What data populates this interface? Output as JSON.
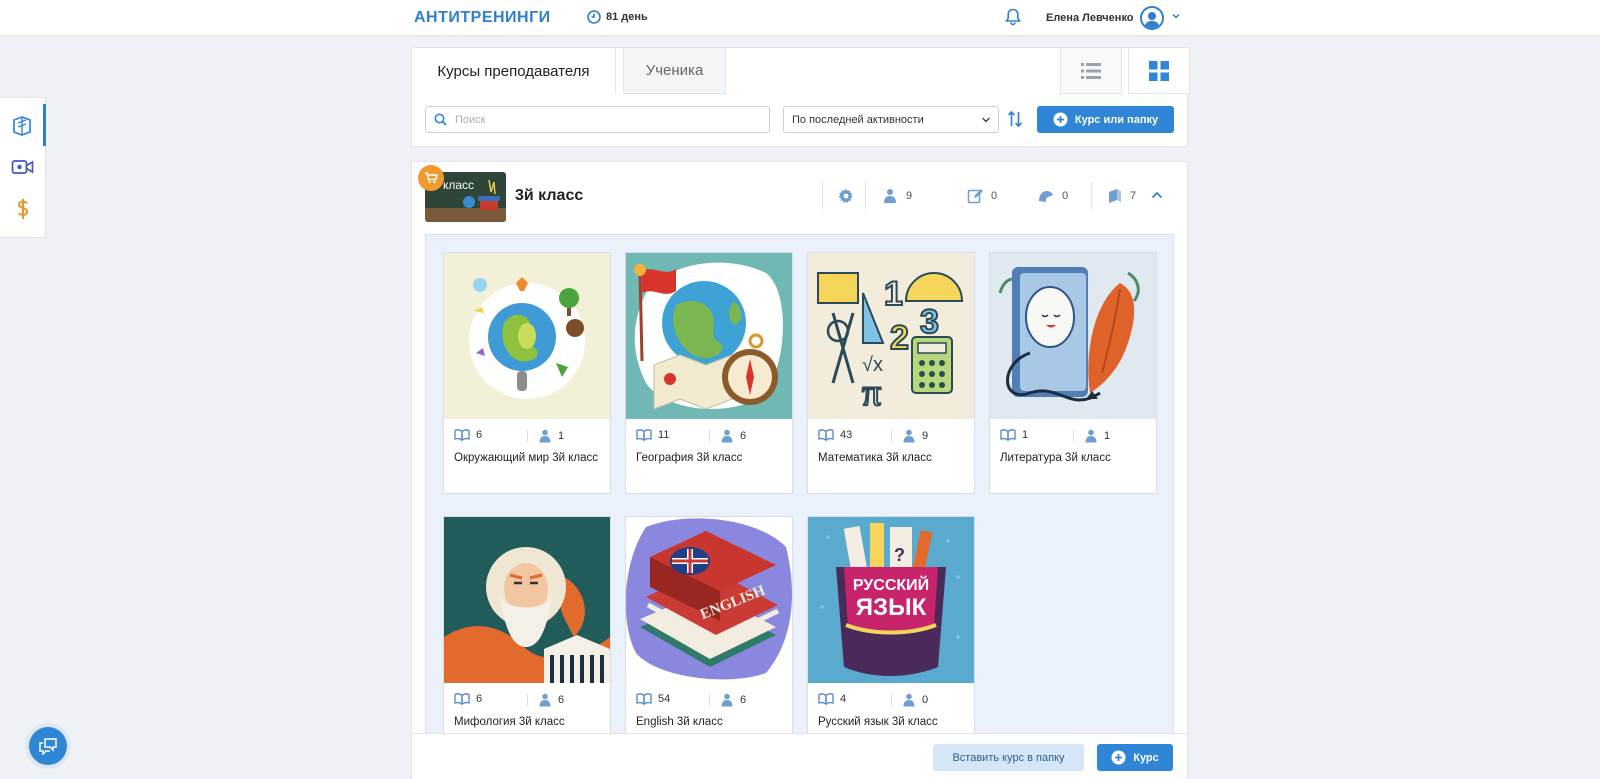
{
  "header": {
    "logo": "АНТИТРЕНИНГИ",
    "days": "81 день",
    "user_name": "Елена Левченко"
  },
  "sidebar": {
    "items": [
      {
        "icon": "courses-icon",
        "active": true
      },
      {
        "icon": "video-icon",
        "active": false
      },
      {
        "icon": "dollar-icon",
        "active": false
      }
    ]
  },
  "tabs": {
    "teacher": "Курсы преподавателя",
    "student": "Ученика"
  },
  "toolbar": {
    "search_placeholder": "Поиск",
    "sort_value": "По последней активности",
    "add_label": "Курс или папку"
  },
  "folder": {
    "thumb_text": "класс",
    "title": "3й класс",
    "students": "9",
    "tasks": "0",
    "homework": "0",
    "courses": "7"
  },
  "courses": [
    {
      "lessons": "6",
      "students": "1",
      "name": "Окружающий мир 3й класс"
    },
    {
      "lessons": "11",
      "students": "6",
      "name": "География 3й класс"
    },
    {
      "lessons": "43",
      "students": "9",
      "name": "Математика 3й класс"
    },
    {
      "lessons": "1",
      "students": "1",
      "name": "Литература 3й класс"
    },
    {
      "lessons": "6",
      "students": "6",
      "name": "Мифология 3й класс"
    },
    {
      "lessons": "54",
      "students": "6",
      "name": "English 3й класс"
    },
    {
      "lessons": "4",
      "students": "0",
      "name": "Русский язык 3й класс"
    }
  ],
  "cover_text": {
    "english": "ENGLISH",
    "russian_1": "РУССКИЙ",
    "russian_2": "ЯЗЫК",
    "math_1": "1",
    "math_2": "2",
    "math_3": "3",
    "math_sqrt": "√x",
    "math_pi": "π"
  },
  "bottom": {
    "paste_label": "Вставить курс в папку",
    "course_label": "Курс"
  },
  "colors": {
    "accent": "#2f86d6",
    "logo": "#2f7fcc",
    "cart_badge": "#f2992e"
  }
}
